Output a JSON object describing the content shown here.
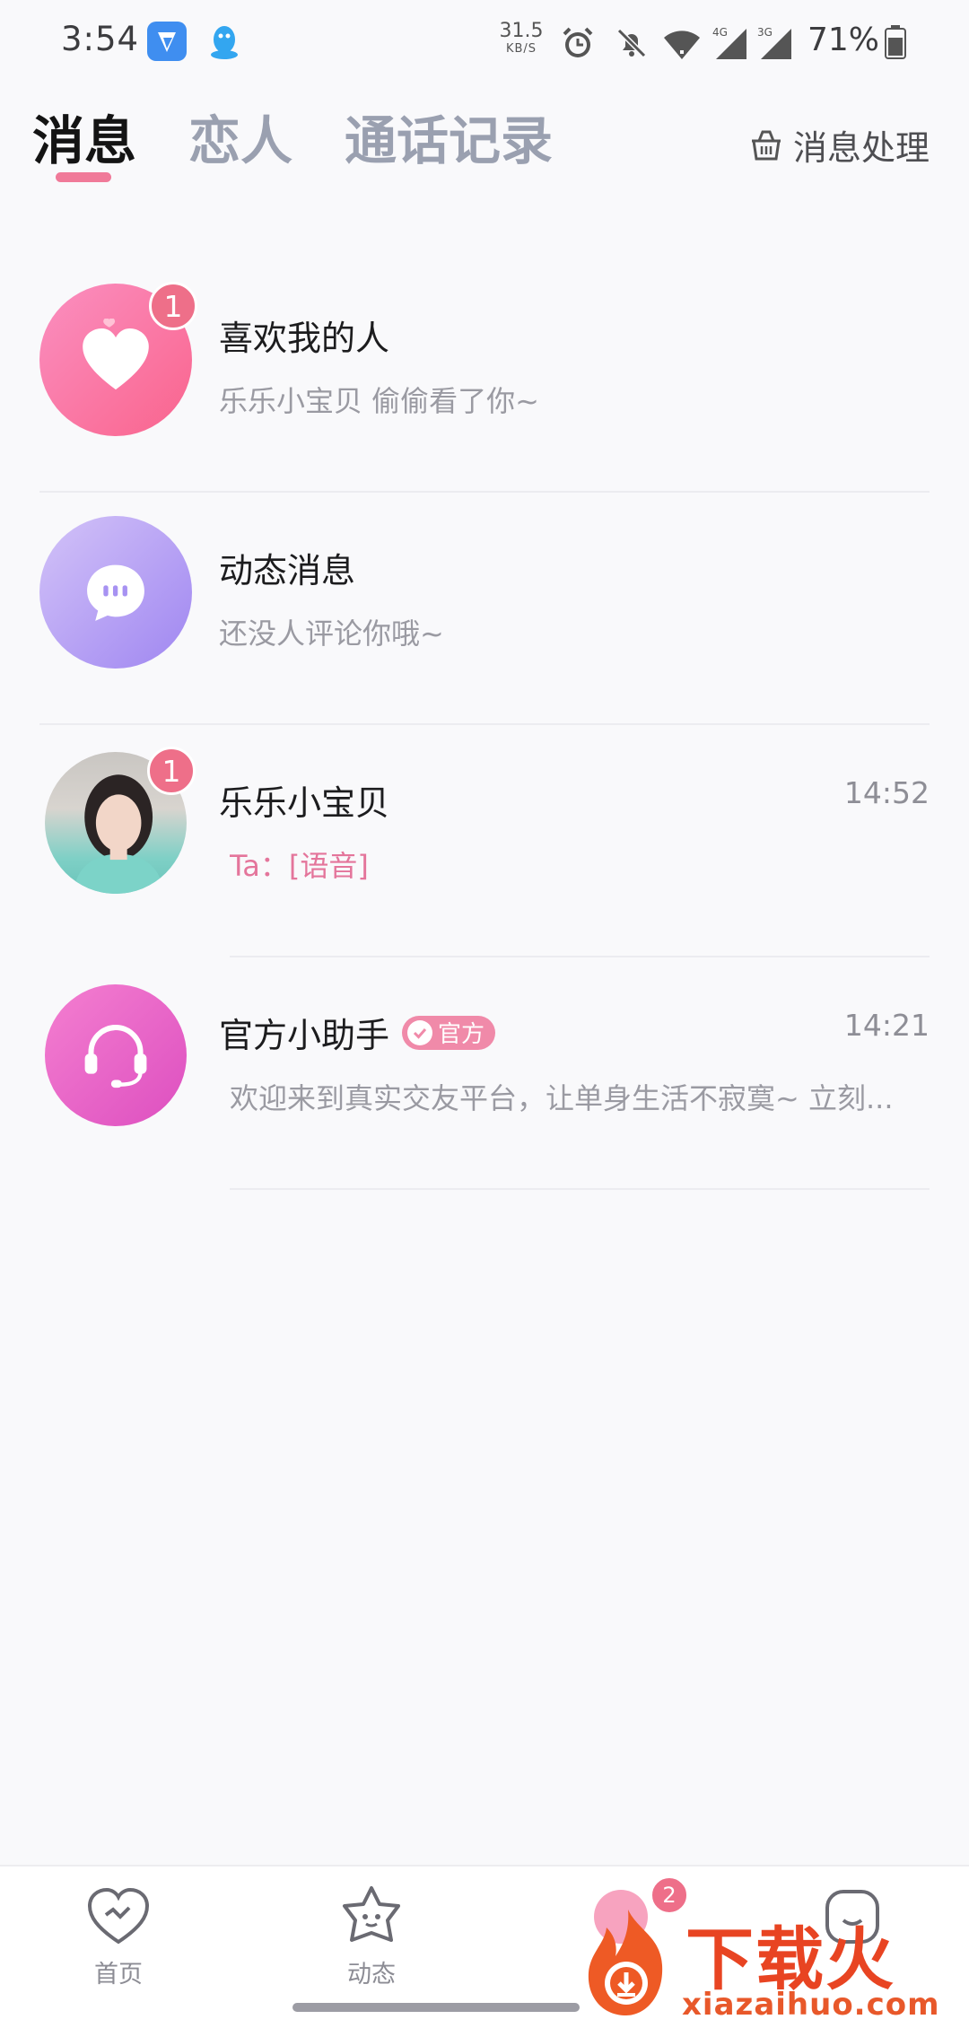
{
  "status_bar": {
    "time": "3:54",
    "net_speed_value": "31.5",
    "net_speed_unit": "KB/S",
    "battery_percent": "71%",
    "icons": [
      "app-notification-icon",
      "qq-icon",
      "alarm-icon",
      "mute-bell-icon",
      "wifi-icon",
      "signal-4g-icon",
      "signal-3g-icon",
      "battery-icon"
    ]
  },
  "header": {
    "tabs": [
      {
        "label": "消息",
        "active": true
      },
      {
        "label": "恋人",
        "active": false
      },
      {
        "label": "通话记录",
        "active": false
      }
    ],
    "manage_label": "消息处理"
  },
  "conversations": [
    {
      "title": "喜欢我的人",
      "preview": "乐乐小宝贝 偷偷看了你~",
      "time": "",
      "badge": "1",
      "avatar_icon": "heart-icon"
    },
    {
      "title": "动态消息",
      "preview": "还没人评论你哦~",
      "time": "",
      "badge": "",
      "avatar_icon": "chat-bubble-icon"
    },
    {
      "title": "乐乐小宝贝",
      "preview": "Ta：[语音]",
      "time": "14:52",
      "badge": "1",
      "avatar_icon": "user-photo"
    },
    {
      "title": "官方小助手",
      "tag": "官方",
      "preview": "欢迎来到真实交友平台，让单身生活不寂寞~ 立刻...",
      "time": "14:21",
      "badge": "",
      "avatar_icon": "headset-icon"
    }
  ],
  "bottom_nav": {
    "items": [
      {
        "label": "首页",
        "icon": "home-heart-icon"
      },
      {
        "label": "动态",
        "icon": "star-face-icon"
      },
      {
        "label": "",
        "icon": "messages-icon"
      },
      {
        "label": "",
        "icon": "profile-icon"
      }
    ],
    "messages_badge": "2"
  },
  "watermark": {
    "title": "下载火",
    "url": "xiazaihuo.com"
  },
  "colors": {
    "accent": "#f07a99",
    "badge": "#ee6f89",
    "voice_text": "#e4759b"
  }
}
